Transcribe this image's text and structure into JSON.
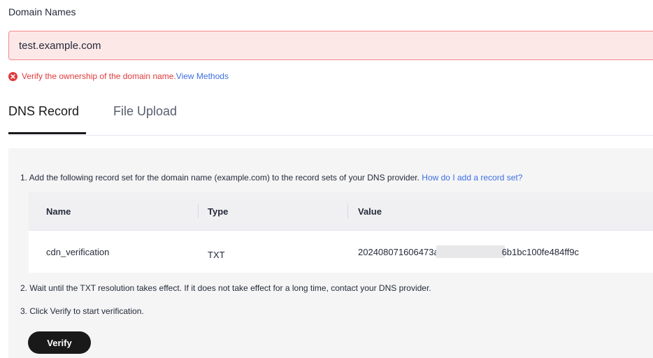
{
  "form": {
    "label": "Domain Names",
    "domain_value": "test.example.com",
    "error_text": "Verify the ownership of the domain name.",
    "error_link": "View Methods",
    "status_color": "#e03b3b"
  },
  "tabs": [
    {
      "label": "DNS Record",
      "active": true
    },
    {
      "label": "File Upload",
      "active": false
    }
  ],
  "dns_panel": {
    "step1_text": "1. Add the following record set for the domain name (example.com) to the record sets of your DNS provider.",
    "step1_link": "How do I add a record set?",
    "table": {
      "headers": [
        "Name",
        "Type",
        "Value"
      ],
      "rows": [
        {
          "name": "cdn_verification",
          "type": "TXT",
          "value_prefix": "202408071606473a",
          "value_suffix": "6b1bc100fe484ff9c"
        }
      ]
    },
    "step2_text": "2. Wait until the TXT resolution takes effect. If it does not take effect for a long time, contact your DNS provider.",
    "step3_text": "3. Click Verify to start verification.",
    "verify_label": "Verify"
  }
}
